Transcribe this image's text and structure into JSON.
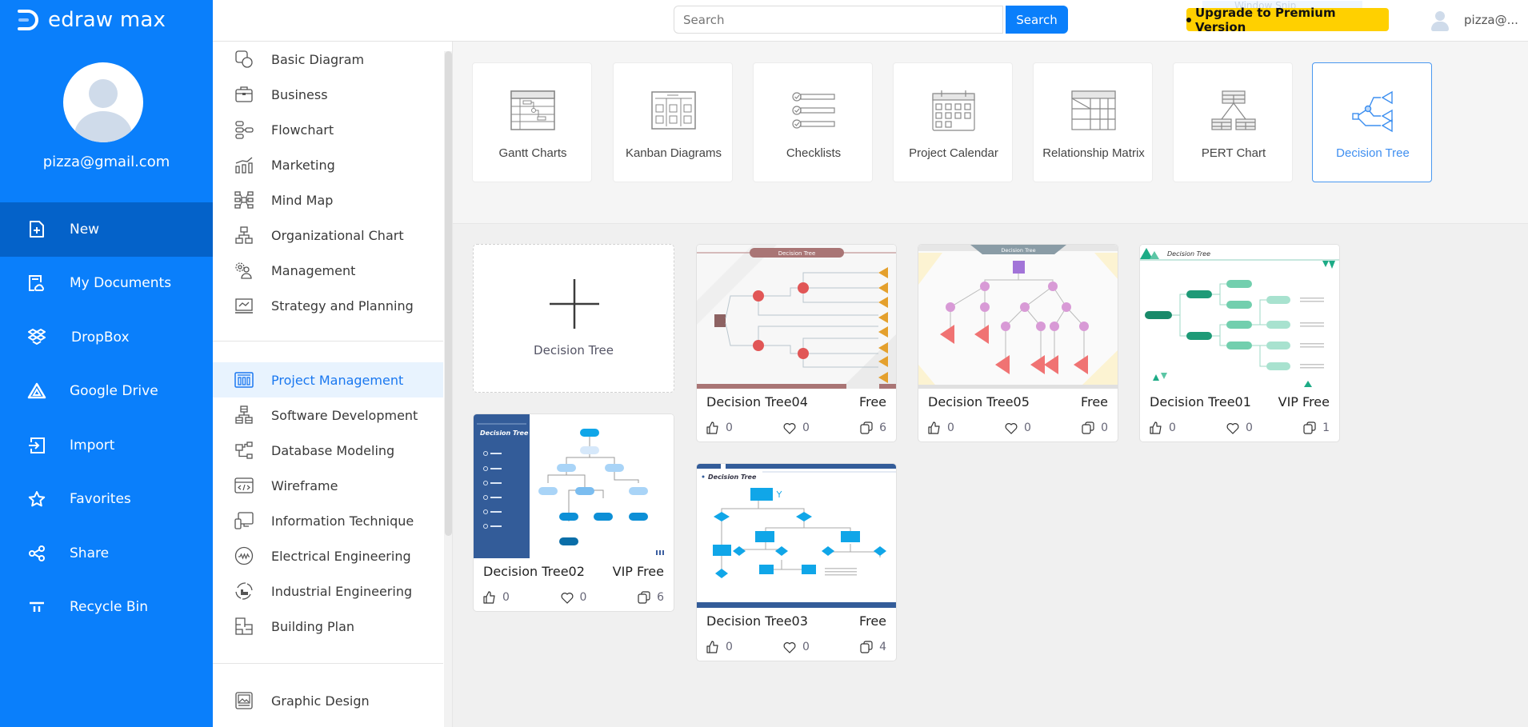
{
  "app": {
    "logo_text": "edraw max"
  },
  "user": {
    "email": "pizza@gmail.com",
    "short_name": "pizza@..."
  },
  "sidebar": {
    "items": [
      {
        "label": "New",
        "icon": "new-file-icon",
        "active": true
      },
      {
        "label": "My Documents",
        "icon": "cloud-document-icon"
      },
      {
        "label": "DropBox",
        "icon": "dropbox-icon"
      },
      {
        "label": "Google Drive",
        "icon": "google-drive-icon"
      },
      {
        "label": "Import",
        "icon": "import-icon"
      },
      {
        "label": "Favorites",
        "icon": "star-icon"
      },
      {
        "label": "Share",
        "icon": "share-icon"
      },
      {
        "label": "Recycle Bin",
        "icon": "recycle-bin-icon"
      }
    ]
  },
  "header": {
    "search_placeholder": "Search",
    "search_button": "Search",
    "upgrade_label": "Upgrade to Premium Version",
    "ghost_text": "Window Snip"
  },
  "categories": {
    "group1": [
      {
        "label": "Basic Diagram",
        "icon": "basic-diagram-icon"
      },
      {
        "label": "Business",
        "icon": "briefcase-icon"
      },
      {
        "label": "Flowchart",
        "icon": "flowchart-icon"
      },
      {
        "label": "Marketing",
        "icon": "bar-chart-icon"
      },
      {
        "label": "Mind Map",
        "icon": "mind-map-icon"
      },
      {
        "label": "Organizational Chart",
        "icon": "org-chart-icon"
      },
      {
        "label": "Management",
        "icon": "management-icon"
      },
      {
        "label": "Strategy and Planning",
        "icon": "strategy-icon"
      }
    ],
    "group2": [
      {
        "label": "Project Management",
        "icon": "project-management-icon",
        "active": true
      },
      {
        "label": "Software Development",
        "icon": "software-dev-icon"
      },
      {
        "label": "Database Modeling",
        "icon": "database-icon"
      },
      {
        "label": "Wireframe",
        "icon": "wireframe-icon"
      },
      {
        "label": "Information Technique",
        "icon": "it-icon"
      },
      {
        "label": "Electrical Engineering",
        "icon": "electrical-icon"
      },
      {
        "label": "Industrial Engineering",
        "icon": "industrial-icon"
      },
      {
        "label": "Building Plan",
        "icon": "building-plan-icon"
      }
    ],
    "group3": [
      {
        "label": "Graphic Design",
        "icon": "graphic-design-icon"
      }
    ]
  },
  "diagram_types": [
    {
      "label": "Gantt Charts",
      "icon": "gantt-icon"
    },
    {
      "label": "Kanban Diagrams",
      "icon": "kanban-icon"
    },
    {
      "label": "Checklists",
      "icon": "checklist-icon"
    },
    {
      "label": "Project Calendar",
      "icon": "calendar-icon"
    },
    {
      "label": "Relationship Matrix",
      "icon": "matrix-icon"
    },
    {
      "label": "PERT Chart",
      "icon": "pert-icon"
    },
    {
      "label": "Decision Tree",
      "icon": "decision-tree-icon",
      "active": true
    }
  ],
  "templates": {
    "new_label": "Decision Tree",
    "items": [
      {
        "title": "Decision Tree04",
        "price": "Free",
        "likes": "0",
        "favorites": "0",
        "copies": "6",
        "thumb_title": "Decision Tree"
      },
      {
        "title": "Decision Tree05",
        "price": "Free",
        "likes": "0",
        "favorites": "0",
        "copies": "0",
        "thumb_title": "Decision Tree"
      },
      {
        "title": "Decision Tree01",
        "price": "VIP Free",
        "likes": "0",
        "favorites": "0",
        "copies": "1",
        "thumb_title": "Decision Tree"
      },
      {
        "title": "Decision Tree02",
        "price": "VIP Free",
        "likes": "0",
        "favorites": "0",
        "copies": "6",
        "thumb_title": "Decision Tree"
      },
      {
        "title": "Decision Tree03",
        "price": "Free",
        "likes": "0",
        "favorites": "0",
        "copies": "4",
        "thumb_title": "Decision Tree"
      }
    ]
  },
  "colors": {
    "brand": "#0a7ffb",
    "active_nav": "#0462c9",
    "upgrade": "#ffd000",
    "accent": "#1a78f0"
  }
}
